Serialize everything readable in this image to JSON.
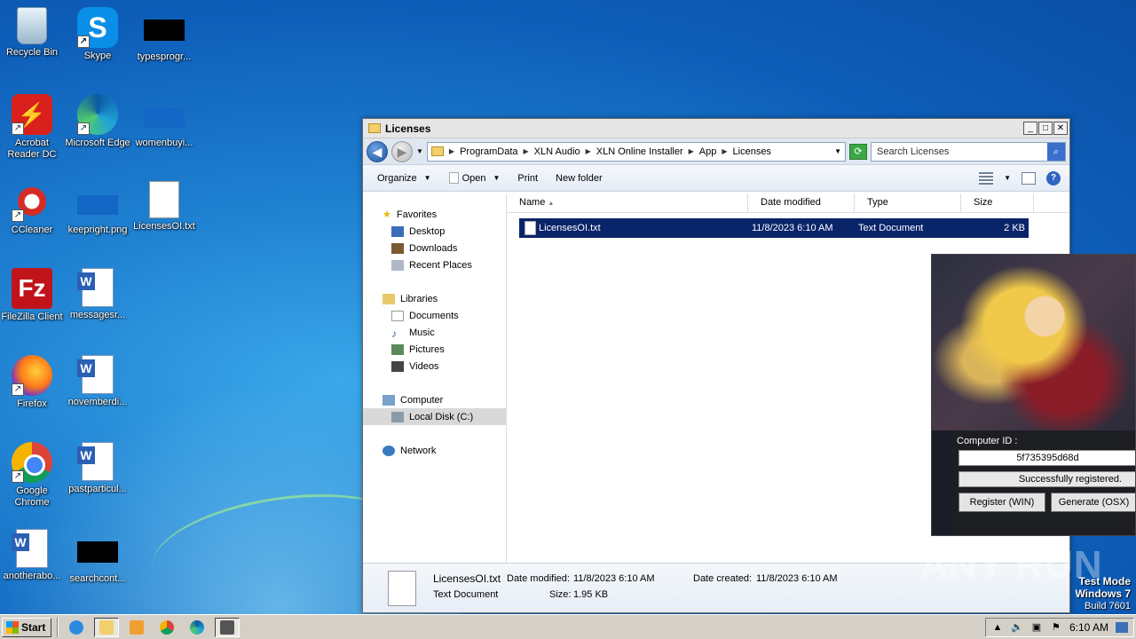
{
  "desktop": {
    "icons": [
      {
        "label": "Recycle Bin"
      },
      {
        "label": "Skype"
      },
      {
        "label": "typesprogr..."
      },
      {
        "label": "Acrobat Reader DC"
      },
      {
        "label": "Microsoft Edge"
      },
      {
        "label": "womenbuyi..."
      },
      {
        "label": "CCleaner"
      },
      {
        "label": "keepright.png"
      },
      {
        "label": "LicensesOI.txt"
      },
      {
        "label": "FileZilla Client"
      },
      {
        "label": "messagesr..."
      },
      {
        "label": "Firefox"
      },
      {
        "label": "novemberdi..."
      },
      {
        "label": "Google Chrome"
      },
      {
        "label": "pastparticul..."
      },
      {
        "label": "anotherabo..."
      },
      {
        "label": "searchcont..."
      }
    ]
  },
  "explorer": {
    "title": "Licenses",
    "breadcrumb": [
      "ProgramData",
      "XLN Audio",
      "XLN Online Installer",
      "App",
      "Licenses"
    ],
    "search_placeholder": "Search Licenses",
    "toolbar": {
      "organize": "Organize",
      "open": "Open",
      "print": "Print",
      "new_folder": "New folder"
    },
    "nav": {
      "favorites": "Favorites",
      "desktop": "Desktop",
      "downloads": "Downloads",
      "recent": "Recent Places",
      "libraries": "Libraries",
      "documents": "Documents",
      "music": "Music",
      "pictures": "Pictures",
      "videos": "Videos",
      "computer": "Computer",
      "localdisk": "Local Disk (C:)",
      "network": "Network"
    },
    "columns": {
      "name": "Name",
      "date": "Date modified",
      "type": "Type",
      "size": "Size"
    },
    "files": [
      {
        "name": "LicensesOI.txt",
        "date": "11/8/2023 6:10 AM",
        "type": "Text Document",
        "size": "2 KB"
      }
    ],
    "details": {
      "name": "LicensesOI.txt",
      "type": "Text Document",
      "modified_label": "Date modified:",
      "modified": "11/8/2023 6:10 AM",
      "created_label": "Date created:",
      "created": "11/8/2023 6:10 AM",
      "size_label": "Size:",
      "size": "1.95 KB"
    }
  },
  "keygen": {
    "computer_id_label": "Computer ID :",
    "computer_id": "5f735395d68d",
    "status": "Successfully registered.",
    "register_btn": "Register (WIN)",
    "generate_btn": "Generate (OSX)"
  },
  "watermark": "ANY RUN",
  "build": {
    "line1": "Test Mode",
    "line2": "Windows 7",
    "line3": "Build 7601"
  },
  "taskbar": {
    "start": "Start",
    "clock": "6:10 AM"
  }
}
